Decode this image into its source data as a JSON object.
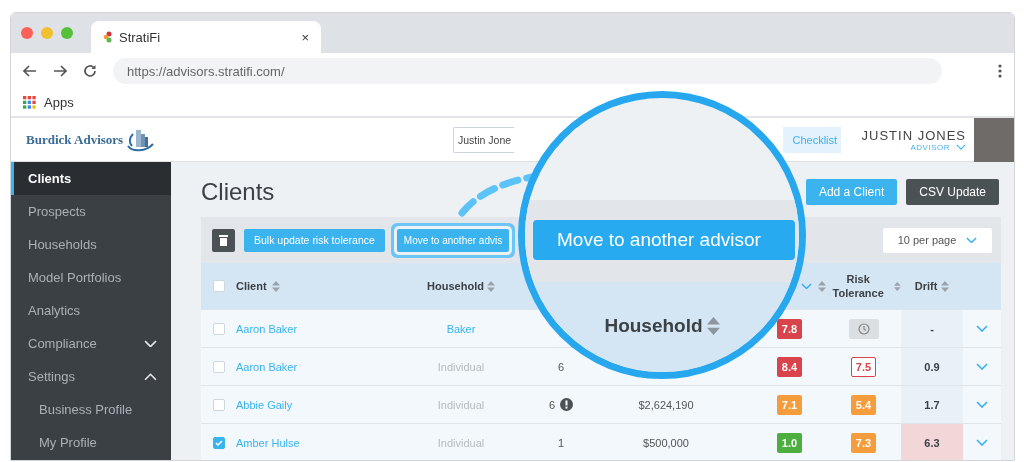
{
  "browser": {
    "tab_title": "StratiFi",
    "tab_close": "×",
    "url": "https://advisors.stratifi.com/",
    "bookmark": "Apps"
  },
  "header": {
    "brand": "Burdick Advisors",
    "search_value": "Justin Jone",
    "checklist": "Checklist",
    "user_name": "JUSTIN JONES",
    "user_role": "ADVISOR"
  },
  "sidebar": {
    "items": [
      {
        "label": "Clients",
        "selected": true
      },
      {
        "label": "Prospects",
        "selected": false
      },
      {
        "label": "Households",
        "selected": false
      },
      {
        "label": "Model Portfolios",
        "selected": false
      },
      {
        "label": "Analytics",
        "selected": false
      },
      {
        "label": "Compliance",
        "selected": false,
        "expanded": false
      },
      {
        "label": "Settings",
        "selected": false,
        "expanded": true,
        "children": [
          {
            "label": "Business Profile",
            "selected": false
          },
          {
            "label": "My Profile",
            "selected": false
          }
        ]
      }
    ]
  },
  "page": {
    "title": "Clients",
    "buttons": [
      {
        "label": "Add a Client",
        "kind": "primary"
      },
      {
        "label": "CSV Update",
        "kind": "dark"
      }
    ]
  },
  "toolbar": {
    "buttons": [
      {
        "label": "Bulk update risk tolerance",
        "highlighted": false
      },
      {
        "label": "Move to another advis",
        "highlighted": true
      }
    ],
    "page_size": "10 per page"
  },
  "table": {
    "all_selected": false,
    "columns": {
      "client": "Client",
      "household": "Household",
      "risk": "Risk Tolerance",
      "drift": "Drift"
    },
    "rows": [
      {
        "selected": false,
        "client": "Aaron Baker",
        "household": "Baker",
        "household_linked": true,
        "score": {
          "value": "7.8",
          "color": "#d9434b"
        },
        "risk": {
          "kind": "pending"
        },
        "drift": "-",
        "drift_alert": false
      },
      {
        "selected": false,
        "client": "Aaron Baker",
        "household": "Individual",
        "household_linked": false,
        "accounts": "6",
        "score": {
          "value": "8.4",
          "color": "#d9434b"
        },
        "risk": {
          "kind": "outline",
          "value": "7.5",
          "color": "#d9434b"
        },
        "drift": "0.9",
        "drift_alert": false
      },
      {
        "selected": false,
        "client": "Abbie Gaily",
        "household": "Individual",
        "household_linked": false,
        "accounts": "6",
        "accounts_alert": true,
        "value": "$2,624,190",
        "score": {
          "value": "7.1",
          "color": "#f59d3d"
        },
        "risk": {
          "kind": "filled",
          "value": "5.4",
          "color": "#f59d3d"
        },
        "drift": "1.7",
        "drift_alert": false
      },
      {
        "selected": true,
        "client": "Amber Hulse",
        "household": "Individual",
        "household_linked": false,
        "accounts": "1",
        "value": "$500,000",
        "score": {
          "value": "1.0",
          "color": "#4cae3f"
        },
        "risk": {
          "kind": "filled",
          "value": "7.3",
          "color": "#f59d3d"
        },
        "drift": "6.3",
        "drift_alert": true
      }
    ]
  },
  "magnifier": {
    "button": "Move to another advisor",
    "column": "Household"
  }
}
